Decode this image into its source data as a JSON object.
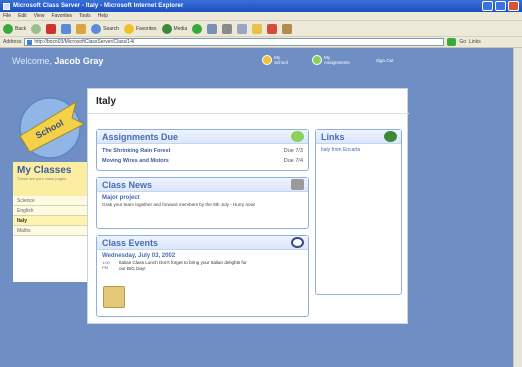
{
  "window": {
    "title": "Microsoft Class Server - Italy - Microsoft Internet Explorer"
  },
  "menu": [
    "File",
    "Edit",
    "View",
    "Favorites",
    "Tools",
    "Help"
  ],
  "toolbar": {
    "back": "Back",
    "search": "Search",
    "favorites": "Favorites",
    "media": "Media"
  },
  "address": {
    "label": "Address",
    "url": "http://bozo03/MicrosoftClassServer/Class/14/",
    "go": "Go",
    "links": "Links"
  },
  "header": {
    "welcome_prefix": "Welcome,",
    "user_name": "Jacob Gray",
    "my_school": [
      "My",
      "School"
    ],
    "my_assignments": [
      "My",
      "Assignments"
    ],
    "sign_out": "Sign Out"
  },
  "logo": {
    "text": "School"
  },
  "sidebar": {
    "title": "My Classes",
    "subtitle": "These are your class pages",
    "items": [
      {
        "label": "Science",
        "active": false
      },
      {
        "label": "English",
        "active": false
      },
      {
        "label": "Italy",
        "active": true
      },
      {
        "label": "Maths",
        "active": false
      }
    ]
  },
  "main": {
    "title": "Italy",
    "assignments": {
      "heading": "Assignments Due",
      "items": [
        {
          "name": "The Shrinking Rain Forest",
          "due": "Due 7/3"
        },
        {
          "name": "Moving Wires and Motors",
          "due": "Due 7/4"
        }
      ]
    },
    "links": {
      "heading": "Links",
      "items": [
        "Italy from Encarta"
      ]
    },
    "news": {
      "heading": "Class News",
      "item_title": "Major project",
      "item_body": "Grab your team together and forward members by the 5th July - Hurry now!"
    },
    "events": {
      "heading": "Class Events",
      "date": "Wednesday, July 03, 2002",
      "time": "1:00 PM",
      "text": "Italian Class Lunch Don't forget to bring your Italian delights for our BIG Day!"
    }
  },
  "colors": {
    "page_bg": "#6f8fc4",
    "accent": "#4a6db0",
    "yellow": "#fbeea0"
  }
}
